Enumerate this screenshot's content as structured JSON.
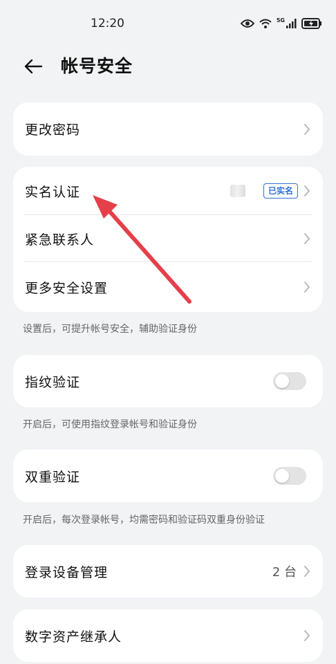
{
  "status_bar": {
    "time": "12:20",
    "network": "5G",
    "icons": [
      "eye-icon",
      "wifi-icon",
      "signal-icon",
      "battery-icon"
    ]
  },
  "header": {
    "back_icon": "arrow-left-icon",
    "title": "帐号安全"
  },
  "cards": {
    "password": {
      "label": "更改密码"
    },
    "security_group": {
      "real_name": {
        "label": "实名认证",
        "badge": "已实名"
      },
      "emergency_contact": {
        "label": "紧急联系人"
      },
      "more_settings": {
        "label": "更多安全设置"
      },
      "hint": "设置后，可提升帐号安全，辅助验证身份"
    },
    "fingerprint": {
      "label": "指纹验证",
      "enabled": false,
      "hint": "开启后，可使用指纹登录帐号和验证身份"
    },
    "two_factor": {
      "label": "双重验证",
      "enabled": false,
      "hint": "开启后，每次登录帐号，均需密码和验证码双重身份验证"
    },
    "devices": {
      "label": "登录设备管理",
      "count": "2 台"
    },
    "inheritor": {
      "label": "数字资产继承人"
    }
  },
  "colors": {
    "background": "#f1f3f5",
    "card": "#ffffff",
    "accent": "#2f6fd6",
    "annotation_arrow": "#e5404a"
  }
}
